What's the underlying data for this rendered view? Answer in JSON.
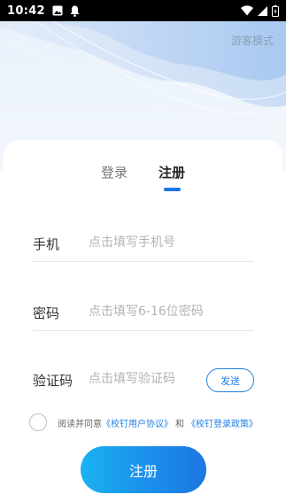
{
  "status_bar": {
    "time": "10:42",
    "icons": [
      "gallery-icon",
      "notification-icon",
      "wifi-icon",
      "signal-icon",
      "battery-icon"
    ]
  },
  "header": {
    "guest_mode": "游客模式"
  },
  "tabs": {
    "login": "登录",
    "register": "注册",
    "active": "register"
  },
  "form": {
    "phone": {
      "label": "手机",
      "placeholder": "点击填写手机号",
      "value": ""
    },
    "password": {
      "label": "密码",
      "placeholder": "点击填写6-16位密码",
      "value": ""
    },
    "code": {
      "label": "验证码",
      "placeholder": "点击填写验证码",
      "value": ""
    },
    "send_label": "发送"
  },
  "agreement": {
    "checked": false,
    "prefix": "阅读并同意",
    "user_agreement": "《校钉用户协议》",
    "and": "和",
    "login_policy": "《校钉登录政策》"
  },
  "submit": {
    "label": "注册"
  },
  "colors": {
    "accent": "#1e7fe4",
    "button_gradient_start": "#1ab2f2",
    "button_gradient_end": "#1d77e2",
    "header_wave": "#bcd6f5"
  }
}
